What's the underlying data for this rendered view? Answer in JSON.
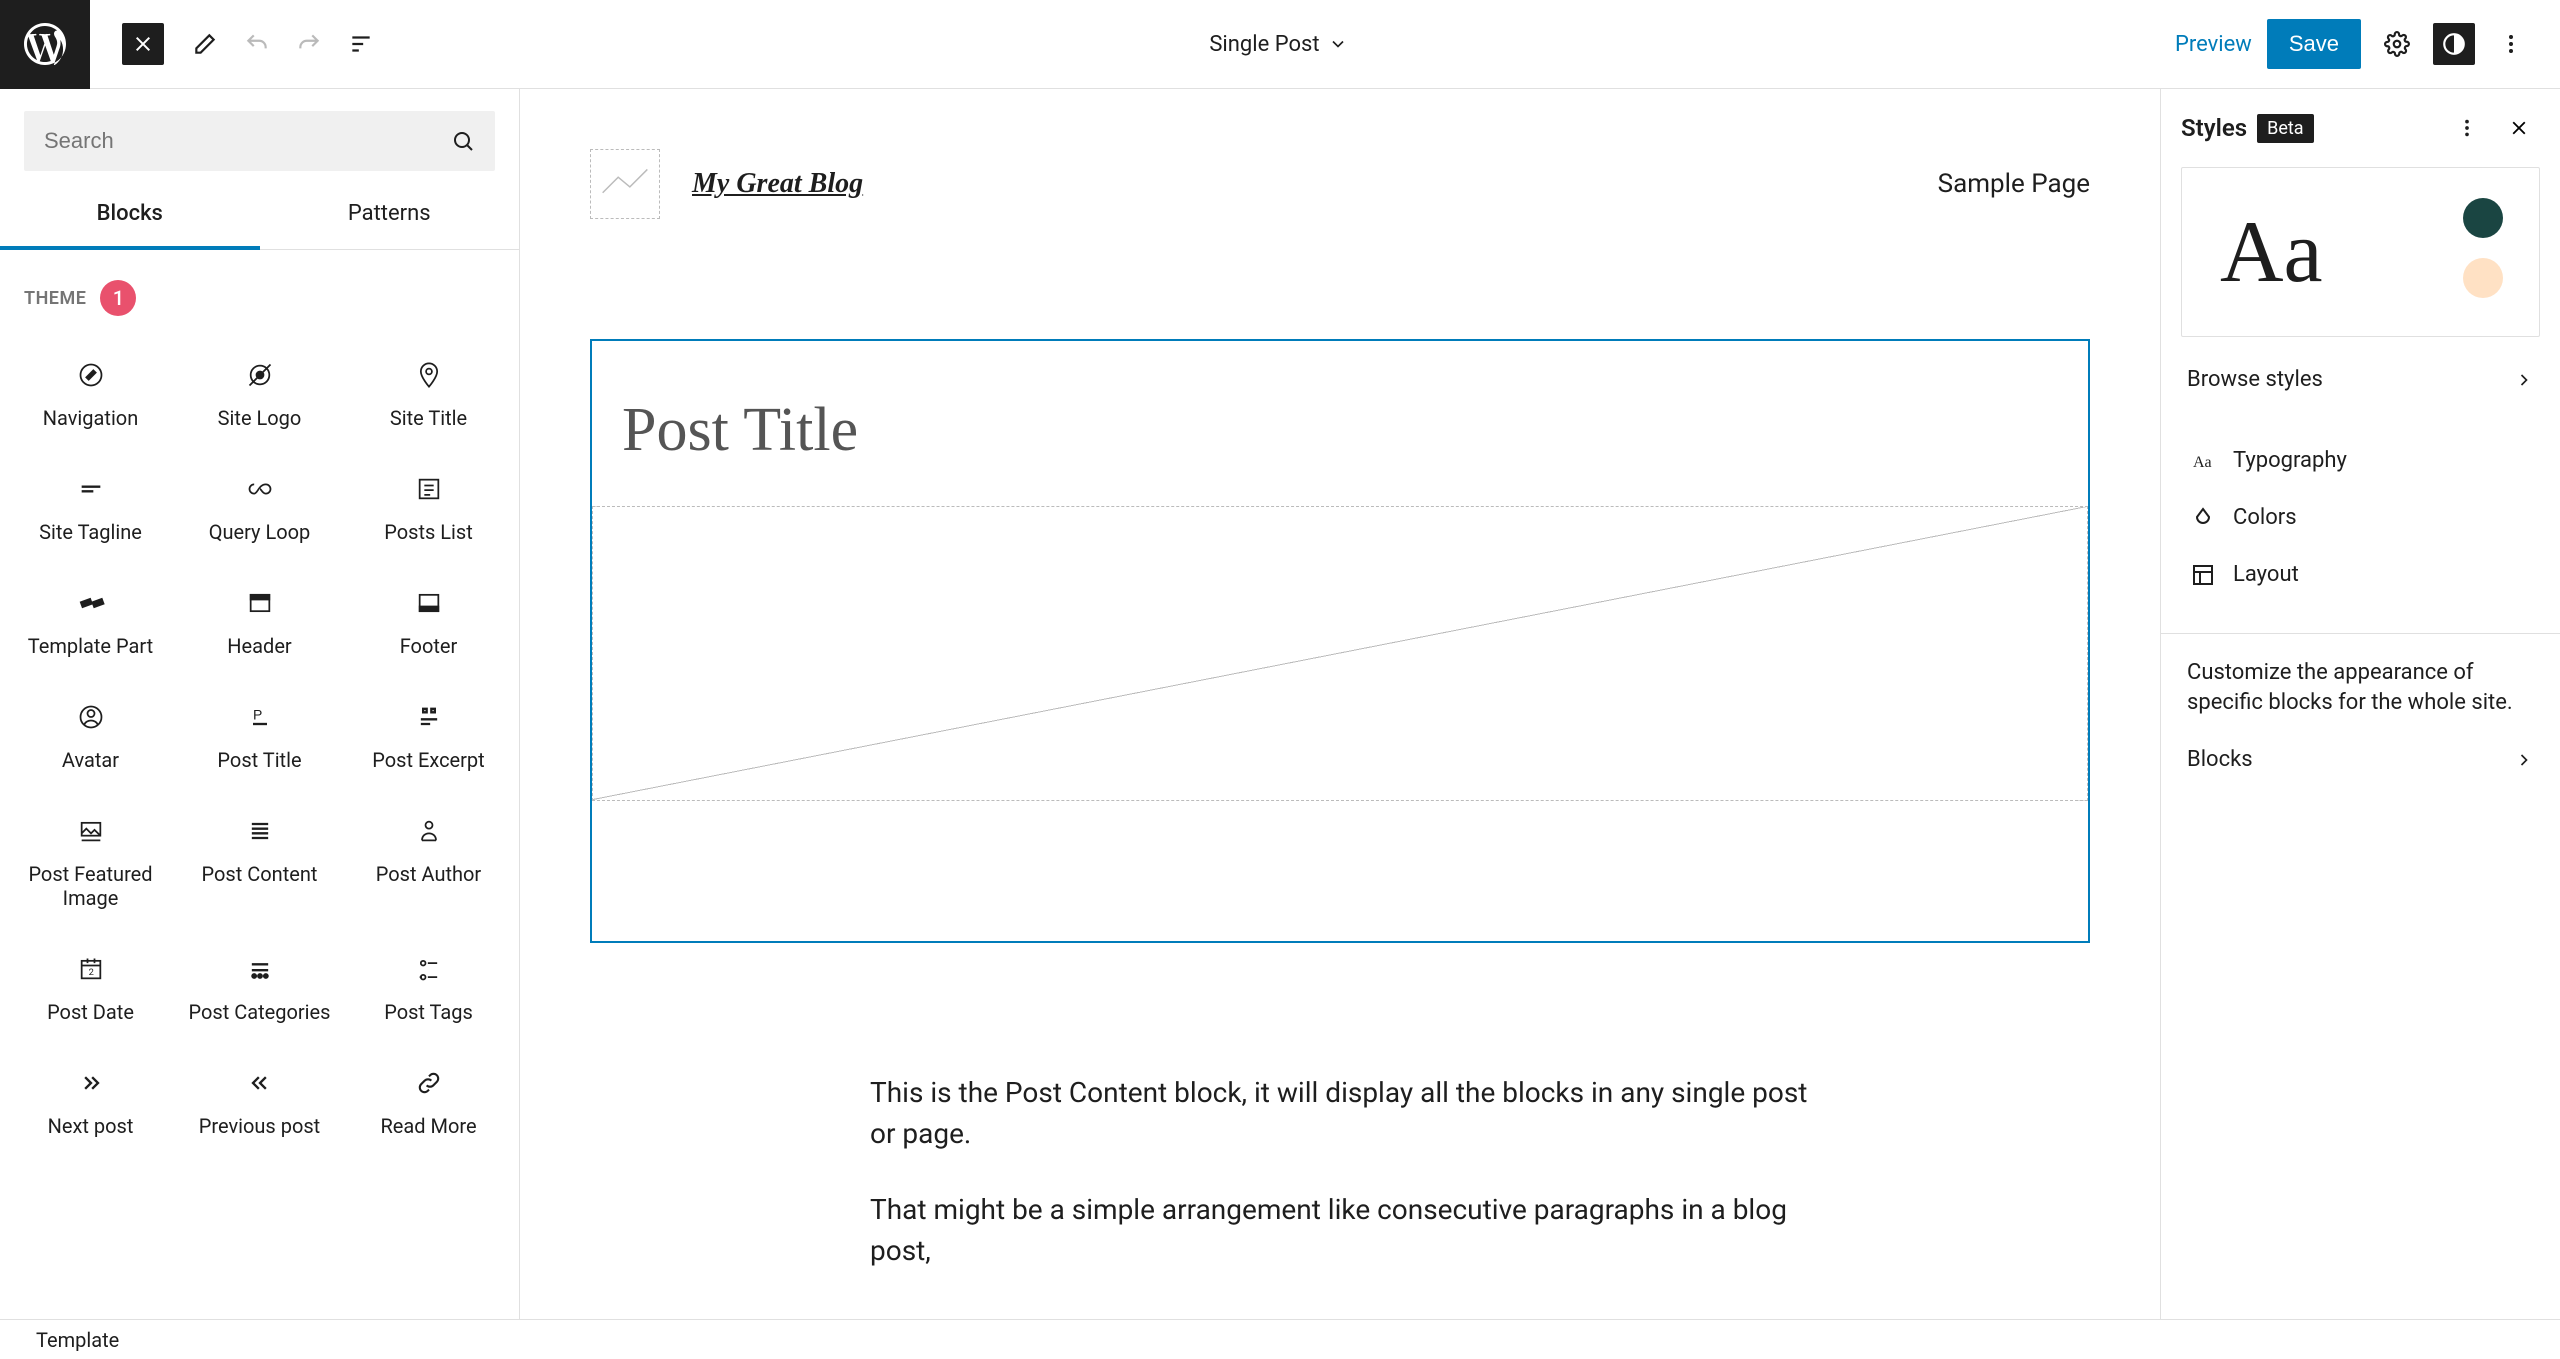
{
  "topbar": {
    "doc_title": "Single Post",
    "preview_label": "Preview",
    "save_label": "Save"
  },
  "inserter": {
    "search_placeholder": "Search",
    "tabs": {
      "blocks": "Blocks",
      "patterns": "Patterns"
    },
    "section_label": "THEME",
    "badge": "1",
    "blocks": [
      {
        "label": "Navigation",
        "icon": "compass"
      },
      {
        "label": "Site Logo",
        "icon": "disc-strike"
      },
      {
        "label": "Site Title",
        "icon": "map-pin"
      },
      {
        "label": "Site Tagline",
        "icon": "lines-short"
      },
      {
        "label": "Query Loop",
        "icon": "infinity"
      },
      {
        "label": "Posts List",
        "icon": "posts-list"
      },
      {
        "label": "Template Part",
        "icon": "tmpl-part"
      },
      {
        "label": "Header",
        "icon": "header"
      },
      {
        "label": "Footer",
        "icon": "footer"
      },
      {
        "label": "Avatar",
        "icon": "avatar"
      },
      {
        "label": "Post Title",
        "icon": "p-letter"
      },
      {
        "label": "Post Excerpt",
        "icon": "excerpt"
      },
      {
        "label": "Post Featured Image",
        "icon": "featured"
      },
      {
        "label": "Post Content",
        "icon": "lines-full"
      },
      {
        "label": "Post Author",
        "icon": "author"
      },
      {
        "label": "Post Date",
        "icon": "calendar"
      },
      {
        "label": "Post Categories",
        "icon": "categories"
      },
      {
        "label": "Post Tags",
        "icon": "tags"
      },
      {
        "label": "Next post",
        "icon": "chevrons-right"
      },
      {
        "label": "Previous post",
        "icon": "chevrons-left"
      },
      {
        "label": "Read More",
        "icon": "link"
      }
    ]
  },
  "canvas": {
    "site_title": "My Great Blog",
    "nav_item": "Sample Page",
    "post_title_ph": "Post Title",
    "para1": "This is the Post Content block, it will display all the blocks in any single post or page.",
    "para2": "That might be a simple arrangement like consecutive paragraphs in a blog post,"
  },
  "styles": {
    "title": "Styles",
    "beta": "Beta",
    "preview_text": "Aa",
    "swatches": [
      "#1a4542",
      "#ffe1c4"
    ],
    "browse": "Browse styles",
    "items": {
      "typography": "Typography",
      "colors": "Colors",
      "layout": "Layout"
    },
    "description": "Customize the appearance of specific blocks for the whole site.",
    "blocks_label": "Blocks"
  },
  "bottom": {
    "template": "Template"
  }
}
